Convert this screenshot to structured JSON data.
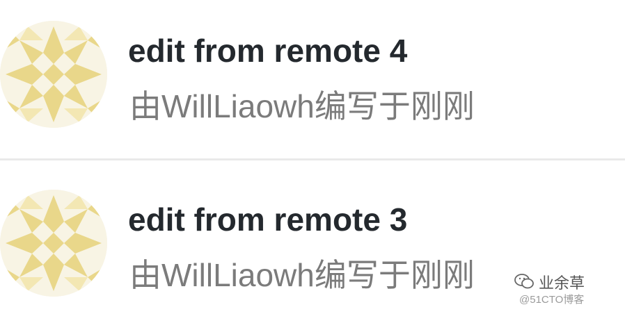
{
  "commits": [
    {
      "title": "edit from remote 4",
      "meta": "由WillLiaowh编写于刚刚",
      "avatar_icon": "identicon-avatar"
    },
    {
      "title": "edit from remote 3",
      "meta": "由WillLiaowh编写于刚刚",
      "avatar_icon": "identicon-avatar"
    }
  ],
  "colors": {
    "avatar_pattern": "#e9d78a",
    "avatar_background": "#f8f4e4",
    "title_text": "#24292e",
    "meta_text": "#7b7b7b",
    "divider": "#e9e9e9"
  },
  "watermark": {
    "title": "业余草",
    "subtitle": "@51CTO博客",
    "icon": "wechat-icon"
  }
}
